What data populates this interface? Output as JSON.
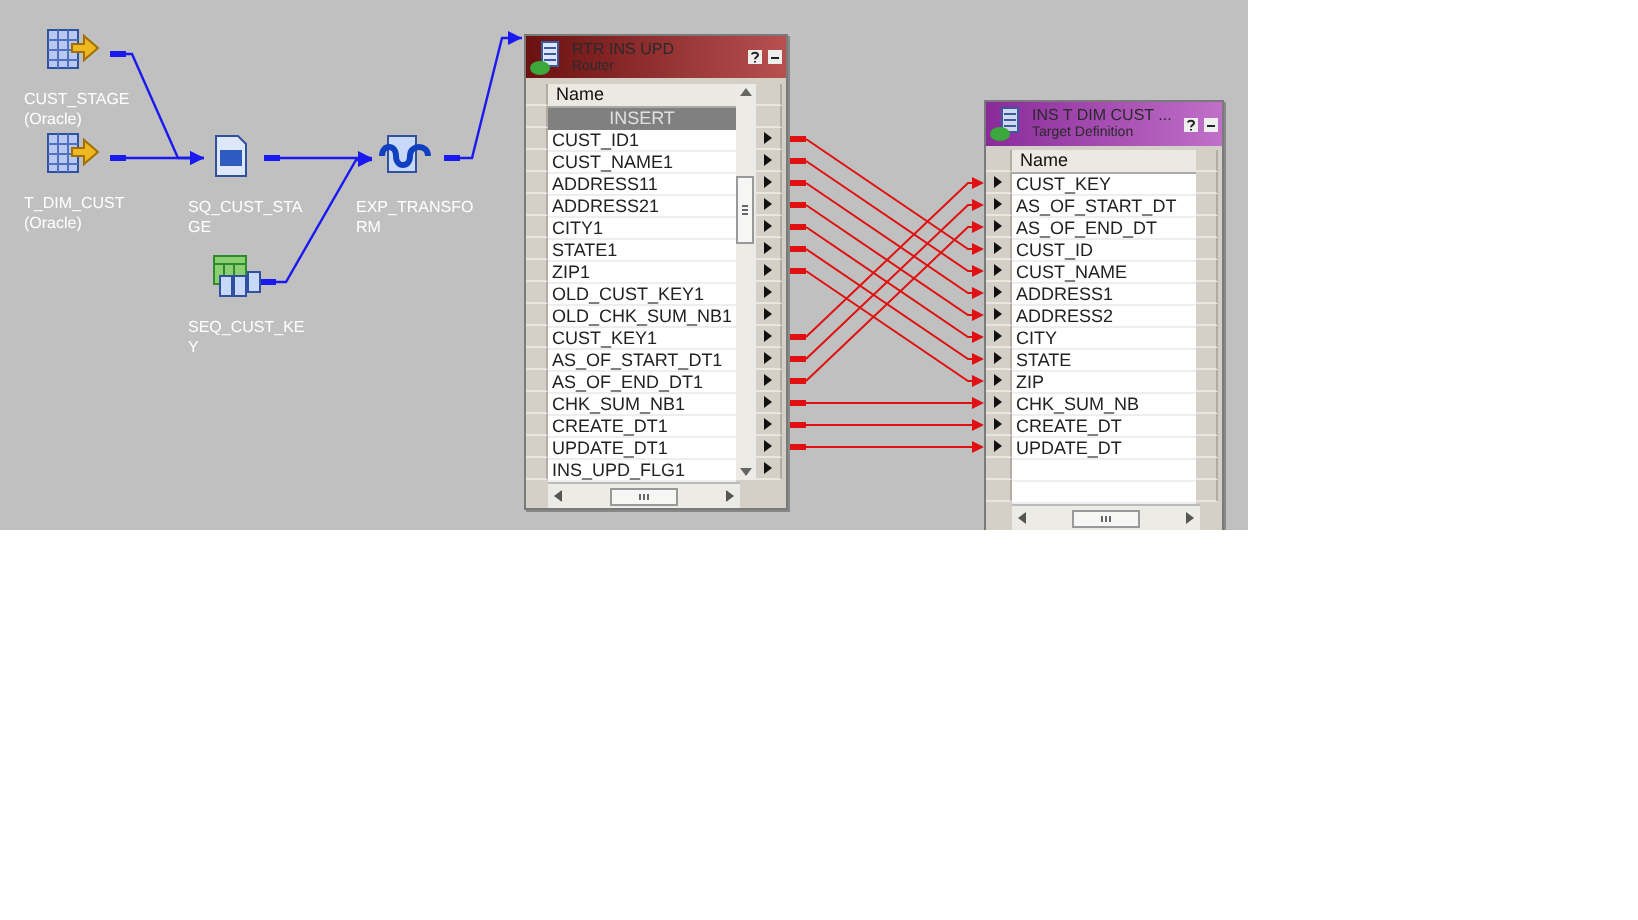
{
  "nodes": [
    {
      "kind": "source",
      "label": "CUST_STAGE (Oracle)"
    },
    {
      "kind": "source",
      "label": "T_DIM_CUST (Oracle)"
    },
    {
      "kind": "qualifier",
      "label": "SQ_CUST_STAGE"
    },
    {
      "kind": "sequence",
      "label": "SEQ_CUST_KEY"
    },
    {
      "kind": "expression",
      "label": "EXP_TRANSFORM"
    }
  ],
  "router": {
    "title": "RTR INS UPD",
    "subtitle": "Router",
    "column": "Name",
    "group": "INSERT",
    "ports": [
      {
        "name": "CUST_ID1",
        "linked": true
      },
      {
        "name": "CUST_NAME1",
        "linked": true
      },
      {
        "name": "ADDRESS11",
        "linked": true
      },
      {
        "name": "ADDRESS21",
        "linked": true
      },
      {
        "name": "CITY1",
        "linked": true
      },
      {
        "name": "STATE1",
        "linked": true
      },
      {
        "name": "ZIP1",
        "linked": true
      },
      {
        "name": "OLD_CUST_KEY1",
        "linked": false
      },
      {
        "name": "OLD_CHK_SUM_NB1",
        "linked": false
      },
      {
        "name": "CUST_KEY1",
        "linked": true
      },
      {
        "name": "AS_OF_START_DT1",
        "linked": true
      },
      {
        "name": "AS_OF_END_DT1",
        "linked": true
      },
      {
        "name": "CHK_SUM_NB1",
        "linked": true
      },
      {
        "name": "CREATE_DT1",
        "linked": true
      },
      {
        "name": "UPDATE_DT1",
        "linked": true
      },
      {
        "name": "INS_UPD_FLG1",
        "linked": false
      }
    ]
  },
  "target": {
    "title": "INS T DIM CUST ...",
    "subtitle": "Target Definition",
    "column": "Name",
    "ports": [
      {
        "name": "CUST_KEY"
      },
      {
        "name": "AS_OF_START_DT"
      },
      {
        "name": "AS_OF_END_DT"
      },
      {
        "name": "CUST_ID"
      },
      {
        "name": "CUST_NAME"
      },
      {
        "name": "ADDRESS1"
      },
      {
        "name": "ADDRESS2"
      },
      {
        "name": "CITY"
      },
      {
        "name": "STATE"
      },
      {
        "name": "ZIP"
      },
      {
        "name": "CHK_SUM_NB"
      },
      {
        "name": "CREATE_DT"
      },
      {
        "name": "UPDATE_DT"
      }
    ]
  }
}
